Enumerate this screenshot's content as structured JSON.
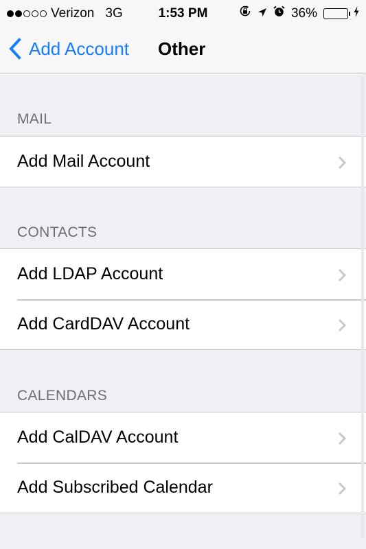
{
  "status_bar": {
    "signal_bars_filled": 2,
    "signal_bars_total": 5,
    "carrier": "Verizon",
    "network": "3G",
    "time": "1:53 PM",
    "icons": [
      "orientation-lock-icon",
      "location-arrow-icon",
      "alarm-icon"
    ],
    "battery_percent_label": "36%",
    "battery_level": 0.36,
    "charging": true,
    "battery_color": "#4cd964"
  },
  "nav": {
    "back_label": "Add Account",
    "title": "Other",
    "accent_color": "#157efb"
  },
  "sections": [
    {
      "header": "MAIL",
      "items": [
        {
          "label": "Add Mail Account"
        }
      ]
    },
    {
      "header": "CONTACTS",
      "items": [
        {
          "label": "Add LDAP Account"
        },
        {
          "label": "Add CardDAV Account"
        }
      ]
    },
    {
      "header": "CALENDARS",
      "items": [
        {
          "label": "Add CalDAV Account"
        },
        {
          "label": "Add Subscribed Calendar"
        }
      ]
    }
  ]
}
